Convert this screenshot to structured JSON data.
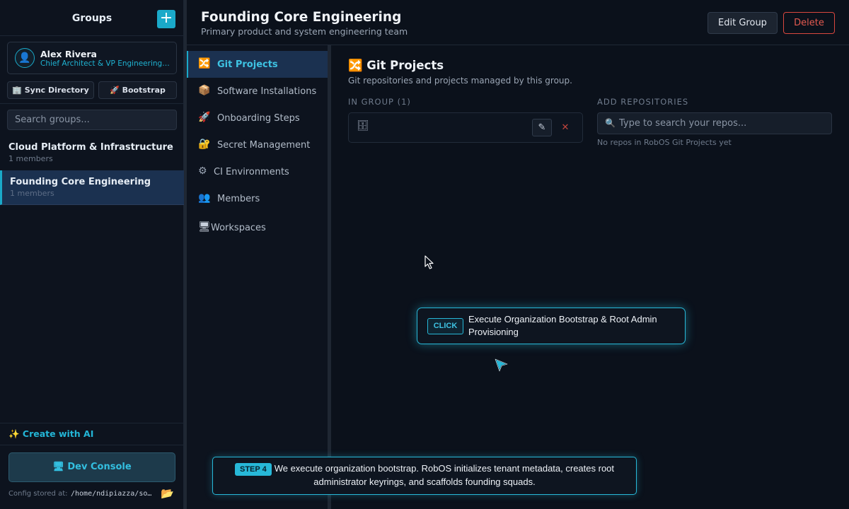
{
  "sidebar": {
    "title": "Groups",
    "add_symbol": "+",
    "user": {
      "avatar_glyph": "👤",
      "name": "Alex Rivera",
      "role": "Chief Architect & VP Engineering · ..."
    },
    "sync_button": "🏢 Sync Directory",
    "bootstrap_button": "🚀 Bootstrap",
    "search_placeholder": "Search groups...",
    "groups": [
      {
        "name": "Cloud Platform & Infrastructure",
        "count": "1 members"
      },
      {
        "name": "Founding Core Engineering",
        "count": "1 members"
      }
    ],
    "create_ai": "✨ Create with AI",
    "dev_console": "🖥 Dev Console",
    "config_label": "Config stored at:",
    "config_path": "/home/ndipiazza/software/robos/config",
    "folder_glyph": "📂"
  },
  "header": {
    "title": "Founding Core Engineering",
    "subtitle": "Primary product and system engineering team",
    "edit_button": "Edit Group",
    "delete_button": "Delete"
  },
  "tabs": [
    {
      "icon": "🔀",
      "label": "Git Projects"
    },
    {
      "icon": "📦",
      "label": "Software Installations"
    },
    {
      "icon": "🚀",
      "label": "Onboarding Steps"
    },
    {
      "icon": "🔐",
      "label": "Secret Management"
    },
    {
      "icon": "⚙",
      "label": "CI Environments"
    },
    {
      "icon": "👥",
      "label": "Members"
    },
    {
      "icon": "🖥",
      "label": "Workspaces"
    }
  ],
  "main": {
    "title": "🔀 Git Projects",
    "subtitle": "Git repositories and projects managed by this group.",
    "in_group_heading": "IN GROUP (1)",
    "add_repos_heading": "ADD REPOSITORIES",
    "repo_icon": "🗄",
    "edit_glyph": "✎",
    "remove_glyph": "✕",
    "search_glyph": "🔍",
    "search_placeholder": "Type to search your repos...",
    "no_repos": "No repos in RobOS Git Projects yet"
  },
  "overlay": {
    "click_badge": "CLICK",
    "callout_text": "Execute Organization Bootstrap & Root Admin Provisioning",
    "step_badge": "STEP 4",
    "step_text": "We execute organization bootstrap. RobOS initializes tenant metadata, creates root administrator keyrings, and scaffolds founding squads."
  },
  "colors": {
    "accent": "#1aa9c9",
    "danger": "#e45a50",
    "active_bg": "#1b3150",
    "background": "#0b111b"
  }
}
